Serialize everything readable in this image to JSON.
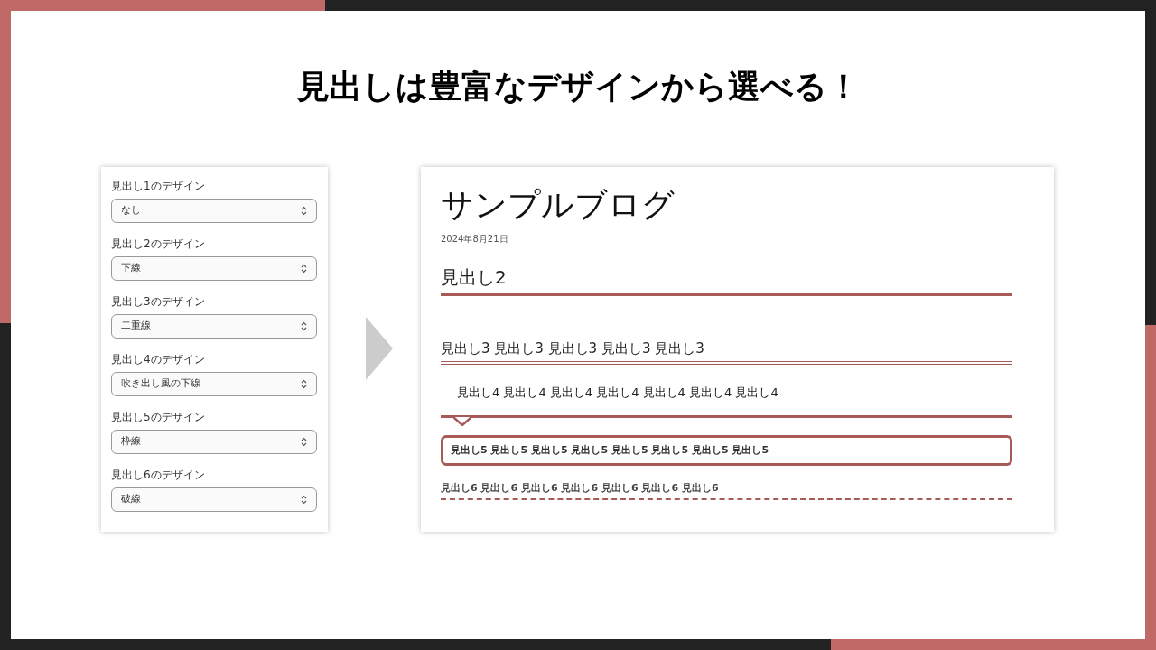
{
  "title": "見出しは豊富なデザインから選べる！",
  "settings": [
    {
      "label": "見出し1のデザイン",
      "value": "なし"
    },
    {
      "label": "見出し2のデザイン",
      "value": "下線"
    },
    {
      "label": "見出し3のデザイン",
      "value": "二重線"
    },
    {
      "label": "見出し4のデザイン",
      "value": "吹き出し風の下線"
    },
    {
      "label": "見出し5のデザイン",
      "value": "枠線"
    },
    {
      "label": "見出し6のデザイン",
      "value": "破線"
    }
  ],
  "preview": {
    "blog_title": "サンプルブログ",
    "date": "2024年8月21日",
    "headings": [
      {
        "kind": "underline",
        "text": "見出し2"
      },
      {
        "kind": "double",
        "text": "見出し3 見出し3 見出し3 見出し3 見出し3"
      },
      {
        "kind": "speech",
        "text": "見出し4 見出し4 見出し4 見出し4 見出し4 見出し4 見出し4"
      },
      {
        "kind": "box",
        "text": "見出し5 見出し5 見出し5 見出し5 見出し5 見出し5 見出し5 見出し5"
      },
      {
        "kind": "dashed",
        "text": "見出し6 見出し6 見出し6 見出し6 見出し6 見出し6 見出し6"
      }
    ]
  }
}
